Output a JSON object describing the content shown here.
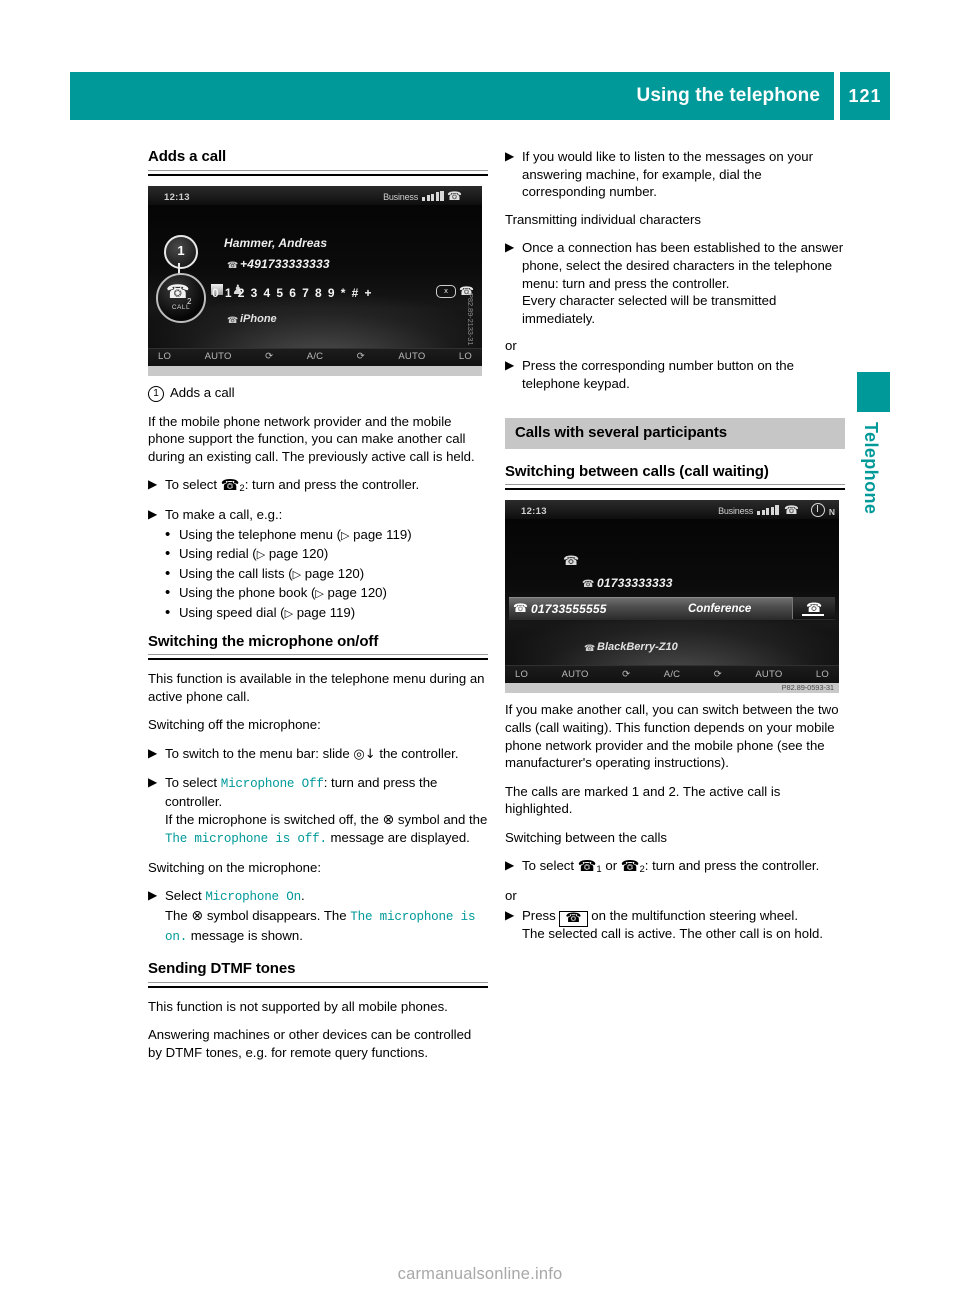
{
  "header": {
    "title": "Using the telephone",
    "page_number": "121"
  },
  "side_tab": {
    "label": "Telephone"
  },
  "watermark": "carmanualsonline.info",
  "left_column": {
    "section1": {
      "heading": "Adds a call",
      "figure": {
        "time": "12:13",
        "carrier": "Business",
        "contact_name": "Hammer, Andreas",
        "contact_number": "+491733333333",
        "keypad_keys": [
          "0",
          "1",
          "2",
          "3",
          "4",
          "5",
          "6",
          "7",
          "8",
          "9",
          "*",
          "#",
          "+"
        ],
        "delete_key": "x",
        "device_label": "iPhone",
        "climate": [
          "LO",
          "AUTO",
          "A/C",
          "AUTO",
          "LO"
        ],
        "code": "P82.89-2133-31"
      },
      "legend_number": "1",
      "legend_text": "Adds a call",
      "para1": "If the mobile phone network provider and the mobile phone support the function, you can make another call during an existing call. The previously active call is held.",
      "step1_pre": "To select",
      "step1_post": ": turn and press the controller.",
      "step2": "To make a call, e.g.:",
      "bullets": [
        "Using the telephone menu (",
        "Using redial (",
        "Using the call lists (",
        "Using the phone book (",
        "Using speed dial ("
      ],
      "bullet_items": [
        {
          "text": "Using the telephone menu",
          "ref": "page 119"
        },
        {
          "text": "Using redial",
          "ref": "page 120"
        },
        {
          "text": "Using the call lists",
          "ref": "page 120"
        },
        {
          "text": "Using the phone book",
          "ref": "page 120"
        },
        {
          "text": "Using speed dial",
          "ref": "page 119"
        }
      ]
    },
    "section2": {
      "heading": "Switching the microphone on/off",
      "para1": "This function is available in the telephone menu during an active phone call.",
      "para2": "Switching off the microphone:",
      "step1_pre": "To switch to the menu bar: slide",
      "step1_post": "the controller.",
      "step2_pre": "To select",
      "step2_ui": "Microphone Off",
      "step2_mid": ": turn and press the controller.",
      "step2_line2_pre": "If the microphone is switched off, the",
      "step2_line2_mid": "symbol and the",
      "step2_line2_ui": "The microphone is off.",
      "step2_line2_post": "message are displayed.",
      "para3": "Switching on the microphone:",
      "step3_pre": "Select",
      "step3_ui": "Microphone On",
      "step3_post": ".",
      "step3_line2_pre": "The",
      "step3_line2_mid": "symbol disappears. The",
      "step3_line2_ui": "The microphone is on.",
      "step3_line2_post": "message is shown."
    },
    "section3": {
      "heading": "Sending DTMF tones",
      "para1": "This function is not supported by all mobile phones.",
      "para2": "Answering machines or other devices can be controlled by DTMF tones, e.g. for remote query functions."
    }
  },
  "right_column": {
    "step_top": "If you would like to listen to the messages on your answering machine, for example, dial the corresponding number.",
    "subheading1": "Transmitting individual characters",
    "step_chars_line1": "Once a connection has been established to the answer phone, select the desired characters in the telephone menu: turn and press the controller.",
    "step_chars_line2": "Every character selected will be transmitted immediately.",
    "or1": "or",
    "step_keypad": "Press the corresponding number button on the telephone keypad.",
    "banner": "Calls with several participants",
    "subheading2": "Switching between calls (call waiting)",
    "figure": {
      "time": "12:13",
      "carrier": "Business",
      "status_letter": "N",
      "held_number": "01733333333",
      "active_number": "01733555555",
      "conference_label": "Conference",
      "device_label": "BlackBerry-Z10",
      "climate": [
        "LO",
        "AUTO",
        "A/C",
        "AUTO",
        "LO"
      ],
      "code": "P82.89-0593-31"
    },
    "para1": "If you make another call, you can switch between the two calls (call waiting). This function depends on your mobile phone network provider and the mobile phone (see the manufacturer's operating instructions).",
    "para2": "The calls are marked 1 and 2. The active call is highlighted.",
    "para3": "Switching between the calls",
    "step_select_pre": "To select",
    "step_select_or": "or",
    "step_select_post": ": turn and press the controller.",
    "or2": "or",
    "step_press_pre": "Press",
    "step_press_post": "on the multifunction steering wheel.",
    "step_press_line2": "The selected call is active. The other call is on hold."
  },
  "colors": {
    "teal": "#009999",
    "banner_gray": "#c6c6c6"
  }
}
